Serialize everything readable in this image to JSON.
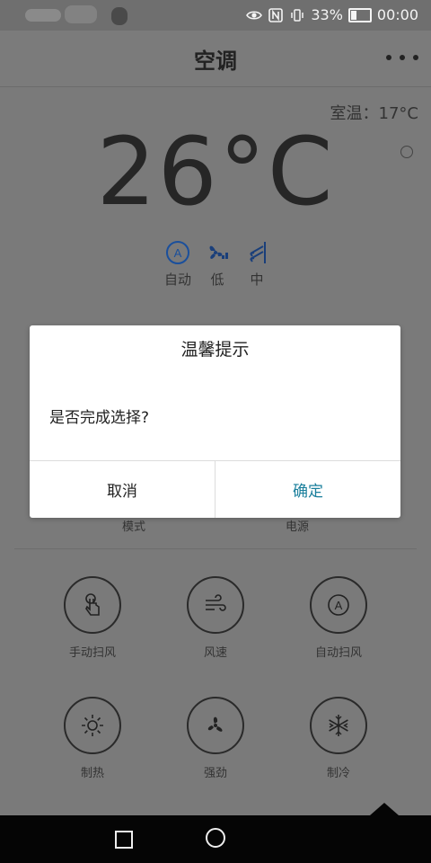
{
  "status_bar": {
    "icons": [
      "eye-icon",
      "nfc-icon",
      "vibrate-icon"
    ],
    "battery": "33%",
    "time": "00:00"
  },
  "header": {
    "title": "空调",
    "more_icon": "more-horizontal-icon"
  },
  "main": {
    "room_temp": "室温：17°C",
    "set_temp": "26°C",
    "modes": [
      {
        "label": "自动",
        "icon": "auto-mode-icon"
      },
      {
        "label": "低",
        "icon": "fan-low-icon"
      },
      {
        "label": "中",
        "icon": "swing-mid-icon"
      }
    ],
    "under_dialog_labels": [
      "模式",
      "电源"
    ],
    "functions": [
      {
        "label": "手动扫风",
        "icon": "hand-touch-icon"
      },
      {
        "label": "风速",
        "icon": "wind-icon"
      },
      {
        "label": "自动扫风",
        "icon": "auto-swing-icon"
      },
      {
        "label": "制热",
        "icon": "sun-icon"
      },
      {
        "label": "强劲",
        "icon": "fan-icon"
      },
      {
        "label": "制冷",
        "icon": "snowflake-icon"
      }
    ]
  },
  "dialog": {
    "title": "温馨提示",
    "message": "是否完成选择?",
    "cancel": "取消",
    "confirm": "确定"
  },
  "colors": {
    "confirm": "#1a7f9c",
    "nav_bg": "#050505"
  }
}
